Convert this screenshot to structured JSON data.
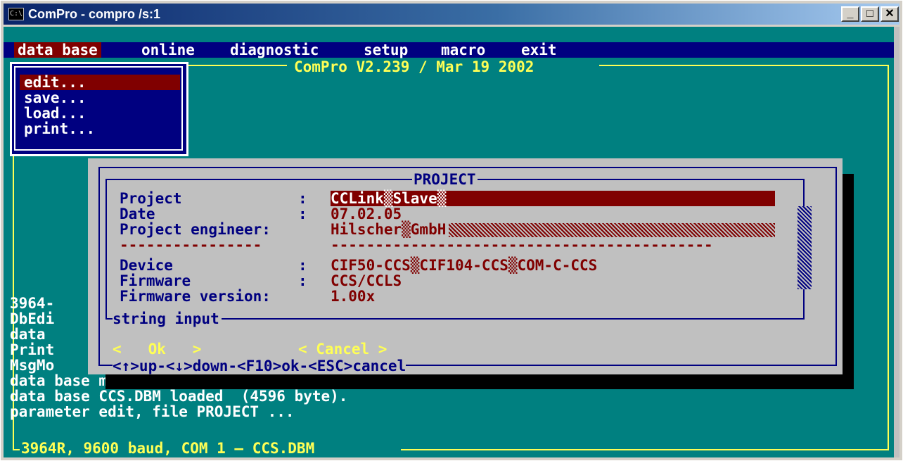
{
  "window": {
    "title": "ComPro - compro /s:1",
    "icon_label": "C:\\",
    "minimize_glyph": "_",
    "maximize_glyph": "□",
    "close_glyph": "✕"
  },
  "menubar": {
    "items": [
      "data base",
      "online",
      "diagnostic",
      "setup",
      "macro",
      "exit"
    ]
  },
  "version_banner": "ComPro V2.239 / Mar 19 2002",
  "dropdown": {
    "items": [
      "edit...",
      "save...",
      "load...",
      "print..."
    ],
    "selected": "edit..."
  },
  "log": {
    "partial_lines": [
      "3964-",
      "DbEdi",
      "data",
      "Print",
      "MsgMo"
    ],
    "lines": [
      "data base memory reorganized.",
      "data base CCS.DBM loaded  (4596 byte).",
      "parameter edit, file PROJECT ..."
    ]
  },
  "status_line": "3964R, 9600 baud, COM 1 — CCS.DBM",
  "dialog": {
    "title": "PROJECT",
    "fields": [
      {
        "label": "Project",
        "colon": ":",
        "value": "CCLink▒Slave▒"
      },
      {
        "label": "Date",
        "colon": ":",
        "value": "07.02.05"
      },
      {
        "label": "Project engineer:",
        "colon": "",
        "value": "Hilscher▒GmbH"
      },
      {
        "label": "Device",
        "colon": ":",
        "value": "CIF50-CCS▒CIF104-CCS▒COM-C-CCS"
      },
      {
        "label": "Firmware",
        "colon": ":",
        "value": "CCS/CCLS"
      },
      {
        "label": "Firmware version:",
        "colon": "",
        "value": "1.00x"
      }
    ],
    "separator_left": "----------------",
    "separator_right": "-------------------------------------------",
    "input_label": "string input",
    "ok_button": "<   Ok   >",
    "cancel_button": "< Cancel >",
    "help_text": "<↑>up-<↓>down-<F10>ok-<ESC>cancel"
  },
  "colors": {
    "console_bg": "#008080",
    "menubar_bg": "#000080",
    "menu_active_bg": "#800000",
    "frame_line": "#ffff55",
    "dialog_bg": "#c0c0c0",
    "dialog_border": "#000080",
    "value_text": "#800000"
  }
}
